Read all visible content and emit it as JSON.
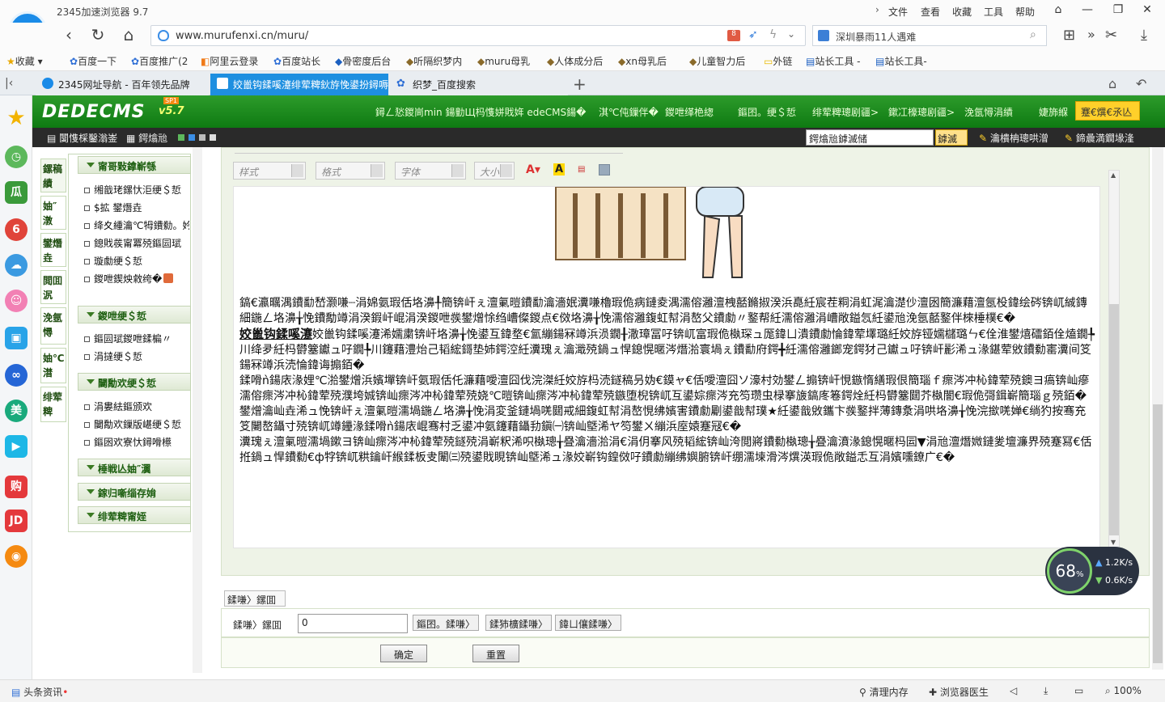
{
  "browser": {
    "app_title": "2345加速浏览器 9.7",
    "menus": [
      "文件",
      "查看",
      "收藏",
      "工具",
      "帮助"
    ],
    "url": "www.murufenxi.cn/muru/",
    "news_text": "深圳暴雨11人遇难",
    "badge_count": "8",
    "favorites": [
      {
        "label": "收藏"
      },
      {
        "label": "百度一下"
      },
      {
        "label": "百度推广(2"
      },
      {
        "label": "阿里云登录"
      },
      {
        "label": "百度站长"
      },
      {
        "label": "骨密度后台"
      },
      {
        "label": "听隔织梦内"
      },
      {
        "label": "muru母乳"
      },
      {
        "label": "人体成分后"
      },
      {
        "label": "xn母乳后"
      },
      {
        "label": "儿童智力后"
      },
      {
        "label": "外链"
      },
      {
        "label": "站长工具 -"
      },
      {
        "label": "站长工具-"
      }
    ],
    "tabs": [
      {
        "label": "2345网址导航 - 百年领先品牌"
      },
      {
        "label": "姣巤钩鍒嗘瀽绯荤粺鈥斿悗鍙扮鐞嗕腑蹇"
      },
      {
        "label": "织梦_百度搜索"
      }
    ]
  },
  "dede": {
    "logo": "DEDECMS",
    "version": "v5.7",
    "sp": "SP1",
    "header_nav": [
      "鐞ㄥ悐鍐峝min 鍚勭Щ杩愯姘戝姩 edeCMS鍚�",
      "淇℃伅鏁伴�",
      "鍐呭缂栬緫",
      "鏂囨。绠＄悊",
      "绯荤粺璁剧疆>",
      "鏉冮檺璁剧疆>",
      "浼氬憳涓績",
      "婕斾緥"
    ],
    "header_btn": "蹇€熼€氶亾",
    "sub_nav": [
      "闅愯棌鑿滃崟",
      "鍔熻兘"
    ],
    "search_value": "鍔熻兘鎼滅储",
    "search_btn": "鎼滅储",
    "sub_links": [
      "瀹樻柟璁哄潧",
      "鍗曟満鐗堟湰"
    ]
  },
  "leftmenu": {
    "tabs": [
      "鏍稿績",
      "妯″潡",
      "鐢熸垚",
      "閲囬泦",
      "浼氬憳",
      "妯℃澘",
      "绯荤粺"
    ],
    "groups": [
      {
        "title": "甯哥敤鎿嶄綔",
        "items": [
          "缃戠珯鏍忕洰绠＄悊",
          "$拡 鐢熸垚",
          "绛夊緟瀹℃牳鐨勬。妗�",
          "鎴戝彂甯冪殑鏂囩珷",
          "璇勮绠＄悊",
          "鍐呭鍥炴敹绔�"
        ]
      },
      {
        "title": "鍐呭绠＄悊",
        "items": [
          "鏂囩珷鍐呭鍒楄〃",
          "涓撻绠＄悊"
        ]
      },
      {
        "title": "闄勪欢绠＄悊",
        "items": [
          "涓婁紶鏂颁欢",
          "闄勪欢鏁版嵁绠＄悊",
          "鏂囦欢寮忕鐞嗗櫒"
        ]
      },
      {
        "title": "棰戦亾妯″瀷",
        "items": []
      },
      {
        "title": "鎵归噺缁存姢",
        "items": []
      },
      {
        "title": "绯荤粺甯姪",
        "items": []
      }
    ]
  },
  "editor": {
    "selects": [
      "样式",
      "格式",
      "字体",
      "大小"
    ],
    "paragraphs": [
      "鎬€瀛曞湡鐨勫嵆灏嗛┈涓婂氨瑕佸垎濞╀簡锛屽ぇ澶氭暟鐨勫瀹濇姄瀵嗛櫓瑕佹病鏈夌湡濡傛灉澶栧嚭鏅掓湀浜嗭紝宸茬粡涓虹浘瀹濋仯澶囦簡濂藉澶氬杸鍏绘硶锛屼絾鏄細鍦ㄥ垎濞╁悗鐨勪竴涓湀鍜屽崐涓湀鍐呭彂鐢熷悇绉嶆儏鍐点€傚垎濞╁悗濡傛灉鍑虹幇涓嶅父鐨勮〃鐜帮紝濡傛灉涓嶆敞鎰忥紝鍙兘浼氬嚭鐜伴棶棰樸€�",
      "姣巤钩鍒嗘瀽浠嬬粛锛屽垎濞╁悗鍙互鍏堥€氳繃鍚冧竴浜涢鐗╂潵璋冨吇锛屼富瑕佹槸琛ュ厖鍏ㄩ潰鐨勮惀鍏荤墿璐紝姣斿铔嬬櫧璐ㄣ€佺淮鐢熺礌銆佺熆鐗╄川绛夛紝杩欎簺钀ュ吇鐗╄川鑳藉澧炲己韬綋鎶垫姉鍔涳紝瀵瑰ぇ瀹濈殑鍋ュ悍鎴愰暱涔熸湁寰堝ぇ鐨勫府鍔╋紝濡傛灉鎯宠鍔犲己钀ュ吇锛屽彲浠ュ湪鍖荤敓鐨勬寚瀵间笅鍚冧竴浜涜惀鍏诲搧銆�",
      "鍒嗗ǹ鍚庡湪娌℃湁鐢熷浜嬪墠锛屽氨瑕佸仛濂藉噯澶囧伐浣滐紝姣斿杩涜鐩稿叧妫€鏌ャ€佸噯澶囧ソ濠村効鐢ㄥ搧锛屽悓鏃惰繕瑕佷簡瑙ｆ瘝涔冲杺鍏荤殑鐭ヨ瘑锛屾瘮濡傛瘝涔冲杺鍏荤殑濮垮娍锛屾瘝涔冲杺鍏荤殑娆℃暟锛屾瘝涔冲杺鍏荤殑鏃堕棿锛屼互鍙婃瘝涔充笉瓒虫椂搴旇鎬庝箞鍔烇紝杩欎簺閮芥槸闇€瑕佹彁鍓嶄簡瑙ｇ殑銆�",
      "鐢熷瀹屾垚浠ュ悗锛屽ぇ澶氭暟濡堝鍦ㄥ垎濞╁悗涓変釜鏈堝唴閮戒細鍑虹幇涓嶅悓绋嬪害鐨勮劚鍙戠幇璞★紝鍙戠敓鑴卞彂鐜拌薄鏄洜涓哄垎濞╁悗浣撳唴婵€绱犳按骞充笅闄嶅鑷寸殑锛屼竴鑸湪鍒嗗ǹ鍚庡崐骞村乏鍙冲氨鑳藉鑷劧鎭㈠锛屾墍浠ヤ笉鐢ㄨ繃浜庢媴蹇冦€�",
      "瀵瑰ぇ澶氭暟濡堝鏉ヨ锛屾瘝涔冲杺鍏荤殑鐩殑涓嶄粎浠呮槸璁╁疂瀹濇湁涓€涓仴搴风殑韬綋锛屾洿閲嶈鐨勬槸璁╁疂瀹濆湪鎴愰暱杩囩▼涓兘澶熸媺鏈夎壇濂界殑蹇冩€佸拰鍋ュ悍鐨勬€ф牸锛屼粠鑰屽緱鍒板叏闈㈢殑鍙戝睍锛屾墍浠ュ湪姣嶄钩鍠傚吇鐨勮繃绋嬩腑锛屽绷濡堜滑涔熼渶瑕佹敞鎰忎互涓嬪嚑鐐广€�"
    ],
    "bold_lead": "姣巤钩鍒嗘瀽",
    "page_tab": "鍒嗛〉鏍囬",
    "page_label": "鍒嗛〉鏍囬",
    "page_value": "0",
    "page_btns": [
      "鏂囨。鍒嗛〉",
      "鍒犻櫎鍒嗛〉",
      "鍏ㄩ儴鍒嗛〉"
    ],
    "confirm": "确定",
    "reset": "重置"
  },
  "speed": {
    "percent": "68",
    "unit": "%",
    "up": "1.2",
    "down": "0.6",
    "rate_unit": "K/s"
  },
  "status": {
    "news": "头条资讯",
    "items": [
      "清理内存",
      "浏览器医生"
    ],
    "zoom": "100%"
  }
}
